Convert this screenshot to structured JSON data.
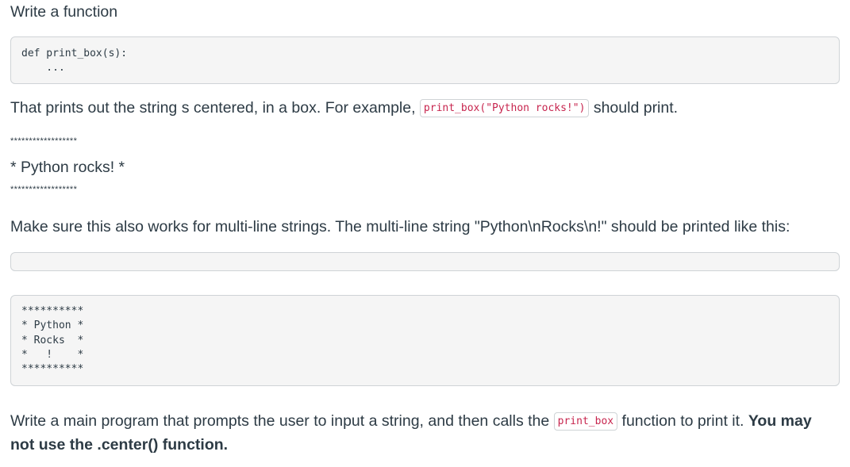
{
  "intro": "Write a function",
  "signature_code": "def print_box(s):\n    ...",
  "example_para": {
    "before": "That prints out the string s centered, in a box. For example, ",
    "code": "print_box(\"Python rocks!\")",
    "after": " should print."
  },
  "example_output": {
    "top_stars": "******************",
    "line": "* Python rocks! *",
    "bottom_stars": "******************"
  },
  "multiline_para": "Make sure this also works for multi-line strings. The multi-line string \"Python\\nRocks\\n!\" should be printed like this:",
  "empty_code": "",
  "multiline_output": "**********\n* Python *\n* Rocks  *\n*   !    *\n**********",
  "final_para": {
    "before": "Write a main program that prompts the user to input a string, and then calls the ",
    "code": "print_box",
    "middle": " function to print it. ",
    "bold_1": "You may",
    "bold_2": "not use the .center() function."
  }
}
